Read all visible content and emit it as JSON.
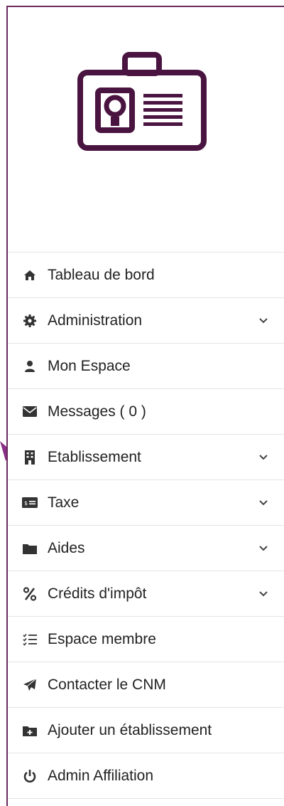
{
  "brand": {
    "logo_icon": "id-badge-icon",
    "accent_color": "#4a1440",
    "border_color": "#6b2a5e"
  },
  "menu": {
    "items": [
      {
        "label": "Tableau de bord",
        "icon": "home-icon",
        "has_submenu": false
      },
      {
        "label": "Administration",
        "icon": "gear-icon",
        "has_submenu": true
      },
      {
        "label": "Mon Espace",
        "icon": "user-icon",
        "has_submenu": false
      },
      {
        "label": "Messages ( 0 )",
        "icon": "envelope-icon",
        "has_submenu": false
      },
      {
        "label": "Etablissement",
        "icon": "building-icon",
        "has_submenu": true
      },
      {
        "label": "Taxe",
        "icon": "money-bill-icon",
        "has_submenu": true
      },
      {
        "label": "Aides",
        "icon": "folder-icon",
        "has_submenu": true
      },
      {
        "label": "Crédits d'impôt",
        "icon": "percent-icon",
        "has_submenu": true
      },
      {
        "label": "Espace membre",
        "icon": "tasks-icon",
        "has_submenu": false
      },
      {
        "label": "Contacter le CNM",
        "icon": "paper-plane-icon",
        "has_submenu": false
      },
      {
        "label": "Ajouter un établissement",
        "icon": "folder-plus-icon",
        "has_submenu": false
      },
      {
        "label": "Admin Affiliation",
        "icon": "power-icon",
        "has_submenu": false
      }
    ]
  }
}
